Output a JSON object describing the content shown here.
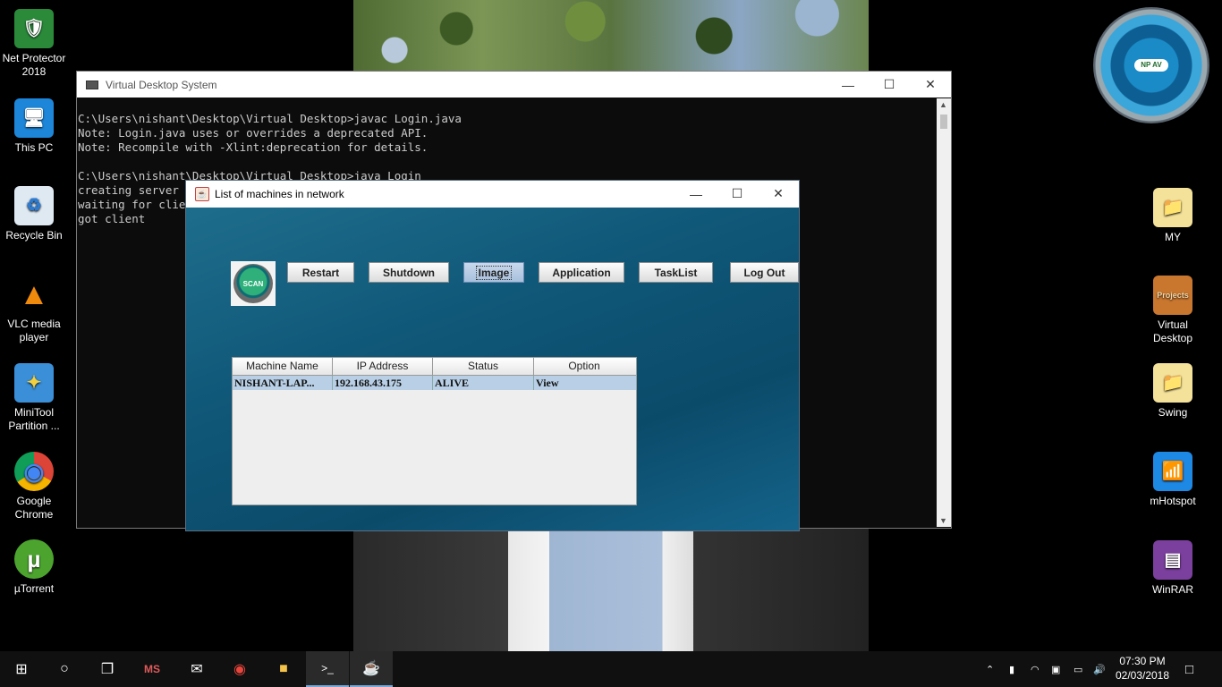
{
  "desktop": {
    "left_icons": [
      {
        "label": "Net Protector 2018",
        "glyph": "🛡"
      },
      {
        "label": "This PC",
        "glyph": "🖥"
      },
      {
        "label": "Recycle Bin",
        "glyph": "♻"
      },
      {
        "label": "VLC media player",
        "glyph": "▲"
      },
      {
        "label": "MiniTool Partition ...",
        "glyph": "✦"
      },
      {
        "label": "Google Chrome",
        "glyph": "◉"
      },
      {
        "label": "µTorrent",
        "glyph": "µ"
      }
    ],
    "right_icons": [
      {
        "label": "MY",
        "glyph": "📁"
      },
      {
        "label": "Virtual Desktop",
        "glyph": "Projects"
      },
      {
        "label": "Swing",
        "glyph": "📁"
      },
      {
        "label": "mHotspot",
        "glyph": "📶"
      },
      {
        "label": "WinRAR",
        "glyph": "▤"
      }
    ],
    "gadget_label": "NP AV"
  },
  "console": {
    "title": "Virtual Desktop System",
    "lines": "C:\\Users\\nishant\\Desktop\\Virtual Desktop>javac Login.java\nNote: Login.java uses or overrides a deprecated API.\nNote: Recompile with -Xlint:deprecation for details.\n\nC:\\Users\\nishant\\Desktop\\Virtual Desktop>java Login\ncreating server\nwaiting for client\ngot client"
  },
  "swing": {
    "title": "List of machines in network",
    "scan_label": "SCAN",
    "buttons": [
      "Restart",
      "Shutdown",
      "Image",
      "Application",
      "TaskList",
      "Log Out"
    ],
    "table": {
      "headers": [
        "Machine Name",
        "IP Address",
        "Status",
        "Option"
      ],
      "rows": [
        [
          "NISHANT-LAP...",
          "192.168.43.175",
          "ALIVE",
          "View"
        ]
      ]
    }
  },
  "taskbar": {
    "time": "07:30 PM",
    "date": "02/03/2018"
  }
}
